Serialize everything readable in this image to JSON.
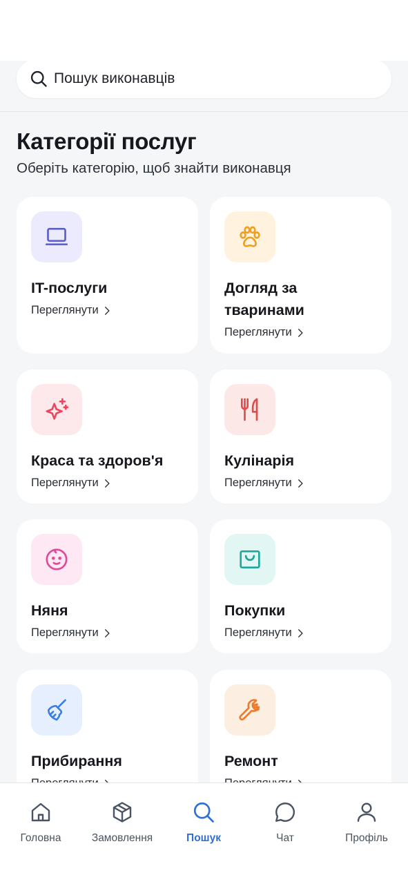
{
  "search": {
    "placeholder": "Пошук виконавців"
  },
  "page": {
    "title": "Категорії послуг",
    "subtitle": "Оберіть категорію, щоб знайти виконавця"
  },
  "categories": [
    {
      "title": "IT-послуги",
      "view_label": "Переглянути",
      "icon": "laptop-icon",
      "icon_color": "#5b5fc7",
      "icon_bg": "#eceafd"
    },
    {
      "title": "Догляд за тваринами",
      "view_label": "Переглянути",
      "icon": "paw-icon",
      "icon_color": "#f0a020",
      "icon_bg": "#fff3df"
    },
    {
      "title": "Краса та здоров'я",
      "view_label": "Переглянути",
      "icon": "sparkles-icon",
      "icon_color": "#e8475f",
      "icon_bg": "#fde8ec"
    },
    {
      "title": "Кулінарія",
      "view_label": "Переглянути",
      "icon": "utensils-icon",
      "icon_color": "#e44a4a",
      "icon_bg": "#fde8e8"
    },
    {
      "title": "Няня",
      "view_label": "Переглянути",
      "icon": "baby-icon",
      "icon_color": "#e04a9a",
      "icon_bg": "#fde8f3"
    },
    {
      "title": "Покупки",
      "view_label": "Переглянути",
      "icon": "shopping-bag-icon",
      "icon_color": "#1fa89a",
      "icon_bg": "#e2f6f3"
    },
    {
      "title": "Прибирання",
      "view_label": "Переглянути",
      "icon": "broom-icon",
      "icon_color": "#3b7fe0",
      "icon_bg": "#e6effd"
    },
    {
      "title": "Ремонт",
      "view_label": "Переглянути",
      "icon": "wrench-icon",
      "icon_color": "#ef7a2a",
      "icon_bg": "#fdeee2"
    }
  ],
  "nav": {
    "active_color": "#2f6fd6",
    "items": [
      {
        "label": "Головна",
        "icon": "home-icon",
        "active": false
      },
      {
        "label": "Замовлення",
        "icon": "package-icon",
        "active": false
      },
      {
        "label": "Пошук",
        "icon": "search-icon",
        "active": true
      },
      {
        "label": "Чат",
        "icon": "chat-icon",
        "active": false
      },
      {
        "label": "Профіль",
        "icon": "user-icon",
        "active": false
      }
    ]
  }
}
